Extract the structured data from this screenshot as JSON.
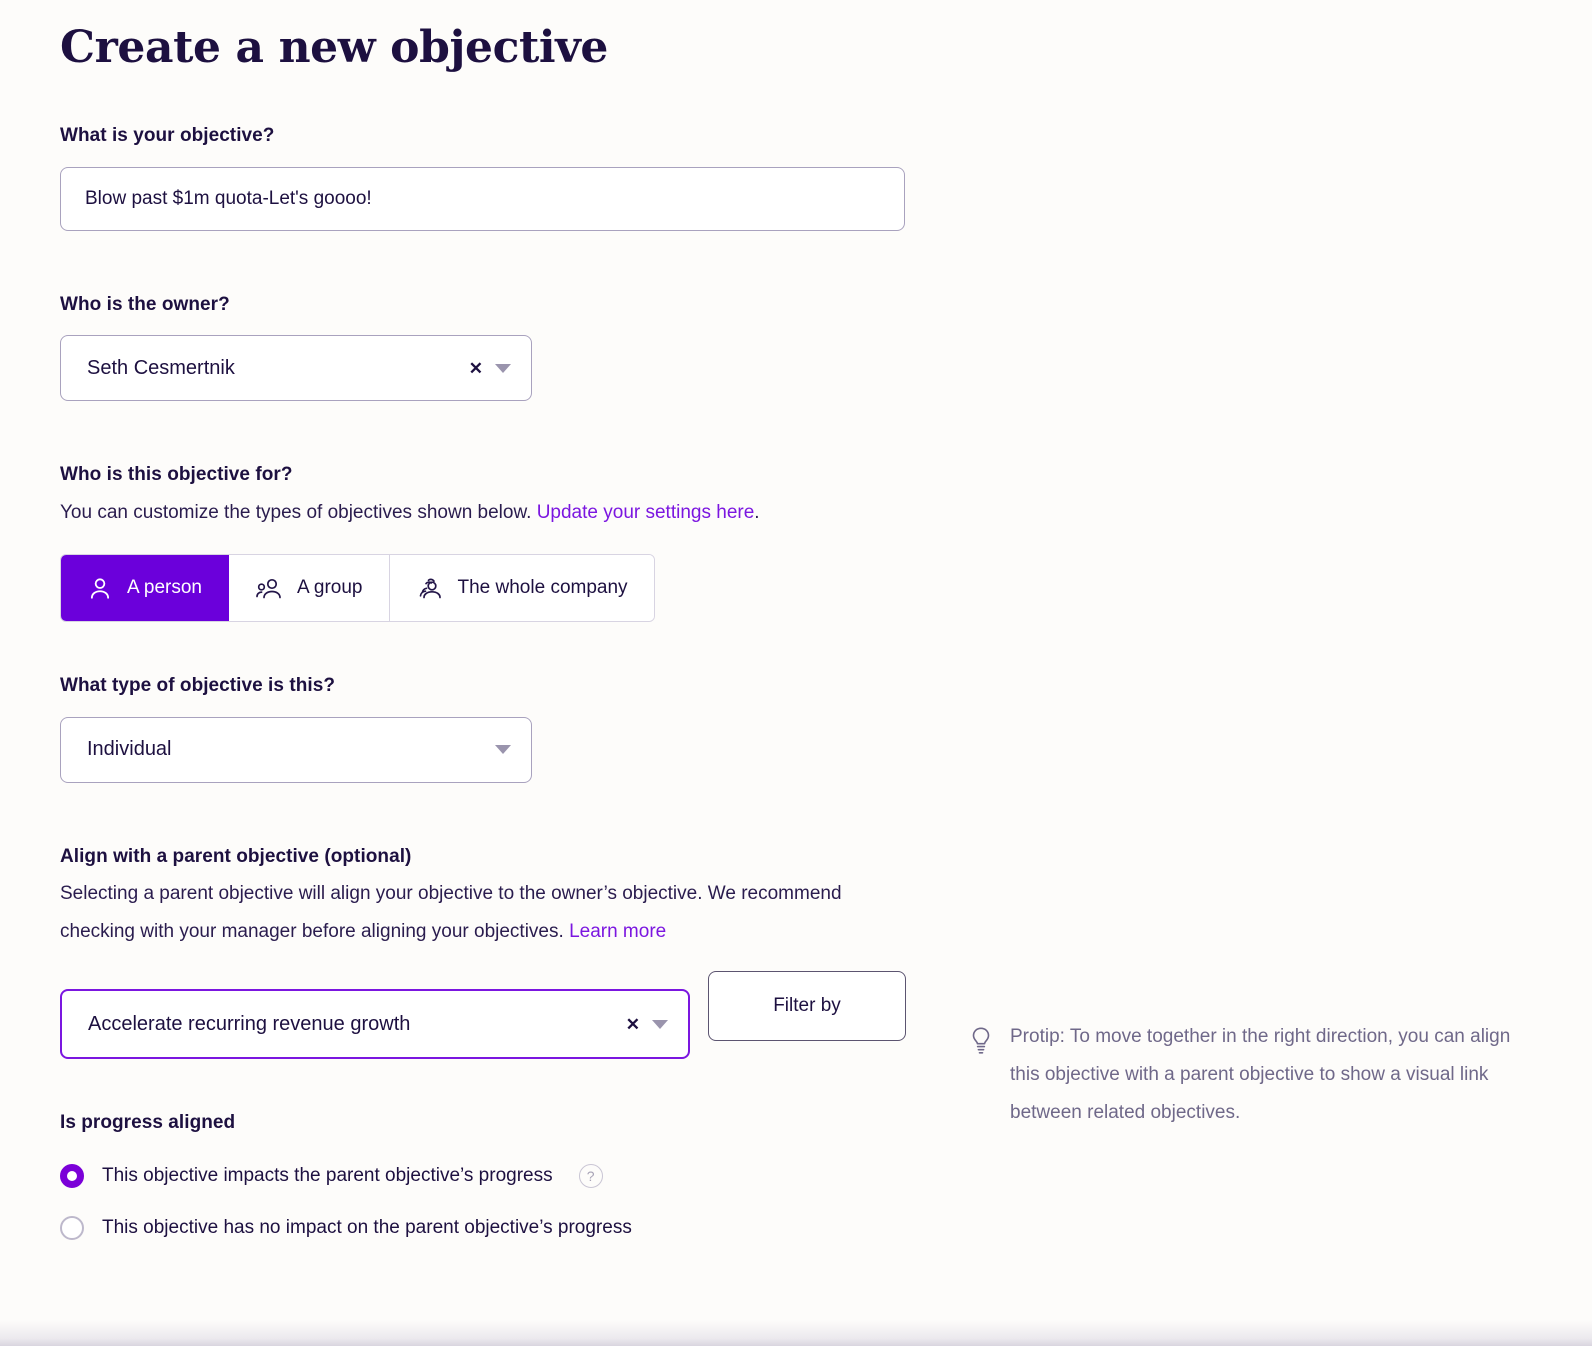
{
  "page": {
    "title": "Create a new objective",
    "accent_color": "#6B00DB",
    "link_color": "#7B16E0",
    "text_color": "#1D1040",
    "background_color": "#FDFCFA"
  },
  "objective_field": {
    "label": "What is your objective?",
    "value": "Blow past $1m quota-Let's goooo!",
    "placeholder": "What is your objective?"
  },
  "owner_field": {
    "label": "Who is the owner?",
    "value": "Seth Cesmertnik",
    "clear_icon": "close-icon",
    "caret_icon": "chevron-down-icon"
  },
  "audience": {
    "label": "Who is this objective for?",
    "description_prefix": "You can customize the types of objectives shown below. ",
    "link_text": "Update your settings here",
    "description_suffix": ".",
    "options": [
      {
        "label": "A person",
        "icon": "person-icon",
        "selected": true
      },
      {
        "label": "A group",
        "icon": "group-icon",
        "selected": false
      },
      {
        "label": "The whole company",
        "icon": "company-icon",
        "selected": false
      }
    ]
  },
  "objective_type": {
    "label": "What type of objective is this?",
    "value": "Individual",
    "caret_icon": "chevron-down-icon"
  },
  "parent_objective": {
    "label": "Align with a parent objective (optional)",
    "description_prefix": "Selecting a parent objective will align your objective to the owner’s objective. We recommend checking with your manager before aligning your objectives. ",
    "link_text": "Learn more",
    "value": "Accelerate recurring revenue growth",
    "clear_icon": "close-icon",
    "caret_icon": "chevron-down-icon",
    "filter_button_label": "Filter by"
  },
  "progress_alignment": {
    "label": "Is progress aligned",
    "options": [
      {
        "label": "This objective impacts the parent objective’s progress",
        "selected": true,
        "has_help_icon": true,
        "help_icon": "question-circle-icon",
        "help_glyph": "?"
      },
      {
        "label": "This objective has no impact on the parent objective’s progress",
        "selected": false,
        "has_help_icon": false,
        "help_icon": "",
        "help_glyph": ""
      }
    ]
  },
  "protip": {
    "icon": "lightbulb-icon",
    "text": "Protip: To move together in the right direction, you can align this objective with a parent objective to show a visual link between related objectives."
  }
}
